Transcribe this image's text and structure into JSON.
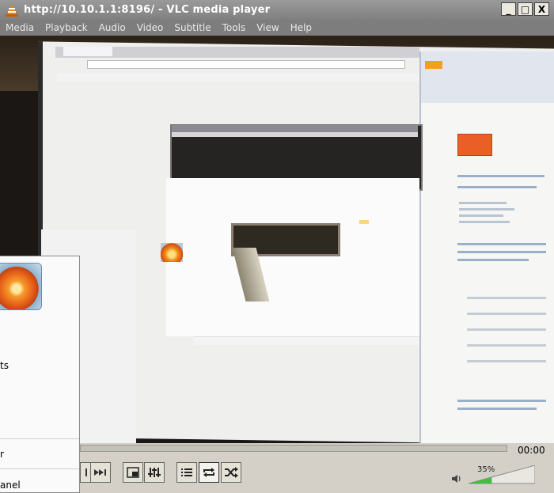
{
  "window": {
    "title": "http://10.10.1.1:8196/ - VLC media player",
    "minimize": "_",
    "maximize": "□",
    "close": "X"
  },
  "menu": [
    "Media",
    "Playback",
    "Audio",
    "Video",
    "Subtitle",
    "Tools",
    "View",
    "Help"
  ],
  "start_menu": {
    "items": [
      "ts",
      "r",
      "anel"
    ]
  },
  "playback": {
    "time": "00:00",
    "volume_percent": "35%",
    "volume_level": 0.35
  },
  "icons": {
    "skip_next": "skip-next-icon",
    "fullscreen": "fullscreen-icon",
    "extended": "extended-settings-icon",
    "playlist": "playlist-icon",
    "loop": "loop-icon",
    "shuffle": "shuffle-icon",
    "volume": "speaker-icon"
  },
  "colors": {
    "titlebar": "#8c8c8c",
    "volume_fill": "#3fbf3f"
  }
}
